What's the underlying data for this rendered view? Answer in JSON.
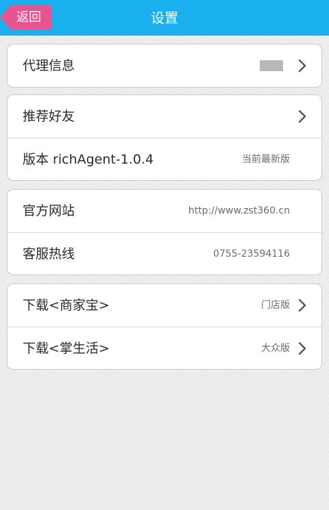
{
  "header": {
    "back_label": "返回",
    "title": "设置",
    "bg_color": "#1ab0f0",
    "back_color": "#e8548f"
  },
  "groups": [
    {
      "rows": [
        {
          "label": "代理信息",
          "value": "",
          "arrow": true
        }
      ]
    },
    {
      "rows": [
        {
          "label": "推荐好友",
          "value": "",
          "arrow": true
        },
        {
          "label": "版本  richAgent-1.0.4",
          "value": "当前最新版",
          "arrow": false
        }
      ]
    },
    {
      "rows": [
        {
          "label": "官方网站",
          "value": "http://www.zst360.cn",
          "arrow": false
        },
        {
          "label": "客服热线",
          "value": "0755-23594116",
          "arrow": false
        }
      ]
    },
    {
      "rows": [
        {
          "label": "下载<商家宝>",
          "value": "门店版",
          "arrow": true
        },
        {
          "label": "下载<掌生活>",
          "value": "大众版",
          "arrow": true
        }
      ]
    }
  ]
}
